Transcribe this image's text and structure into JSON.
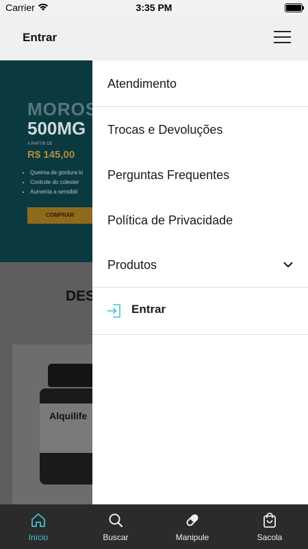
{
  "status_bar": {
    "carrier": "Carrier",
    "time": "3:35 PM"
  },
  "header": {
    "login_label": "Entrar",
    "menu_icon": "hamburger-icon"
  },
  "background": {
    "banner": {
      "title_line1": "MOROS",
      "title_line2": "500MG",
      "from_label": "A PARTIR DE",
      "price": "R$ 145,00",
      "bullets": [
        "Queima de gordura lo",
        "Controle do colester",
        "Aumenta a sensibili"
      ],
      "buy_label": "COMPRAR"
    },
    "section_heading": "DES",
    "product_label": "Alquilife"
  },
  "drawer": {
    "items": [
      {
        "label": "Atendimento"
      },
      {
        "label": "Trocas e Devoluções"
      },
      {
        "label": "Perguntas Frequentes"
      },
      {
        "label": "Política de Privacidade"
      },
      {
        "label": "Produtos"
      }
    ],
    "login_label": "Entrar",
    "login_icon": "sign-in-icon",
    "expand_icon": "chevron-down-icon"
  },
  "tabbar": {
    "tabs": [
      {
        "label": "Início",
        "icon": "home-icon",
        "active": true
      },
      {
        "label": "Buscar",
        "icon": "search-icon",
        "active": false
      },
      {
        "label": "Manipule",
        "icon": "capsule-icon",
        "active": false
      },
      {
        "label": "Sacola",
        "icon": "bag-icon",
        "active": false
      }
    ]
  },
  "colors": {
    "accent": "#46c0d6",
    "tabbar": "#2b2b2b",
    "header": "#f0f0f0"
  }
}
